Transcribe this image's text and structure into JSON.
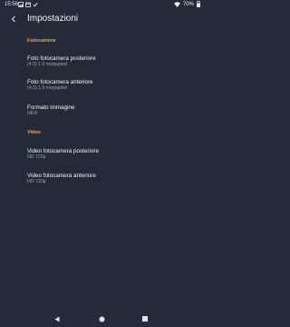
{
  "status_bar": {
    "time": "15:56",
    "battery_percent": "70%",
    "icons": [
      "photo-icon",
      "calendar-icon",
      "check-icon",
      "wifi-icon",
      "battery-icon"
    ]
  },
  "app_bar": {
    "title": "Impostazioni",
    "back_icon": "back-arrow-icon"
  },
  "sections": [
    {
      "header": "Fotocamera",
      "items": [
        {
          "title": "Foto fotocamera posteriore",
          "summary": "(4:3) 1,9 megapixel"
        },
        {
          "title": "Foto fotocamera anteriore",
          "summary": "(4:3) 1,9 megapixel"
        },
        {
          "title": "Formato immagine",
          "summary": "HEIF"
        }
      ]
    },
    {
      "header": "Video",
      "items": [
        {
          "title": "Video fotocamera posteriore",
          "summary": "HD 720p"
        },
        {
          "title": "Video fotocamera anteriore",
          "summary": "HD 720p"
        }
      ]
    }
  ],
  "nav_bar": {
    "icons": [
      "back-triangle-icon",
      "home-circle-icon",
      "recents-square-icon"
    ]
  },
  "colors": {
    "background": "#222b37",
    "accent": "#f0a63a",
    "text_primary": "#f2f5f8",
    "text_secondary": "#9aa5b1"
  }
}
